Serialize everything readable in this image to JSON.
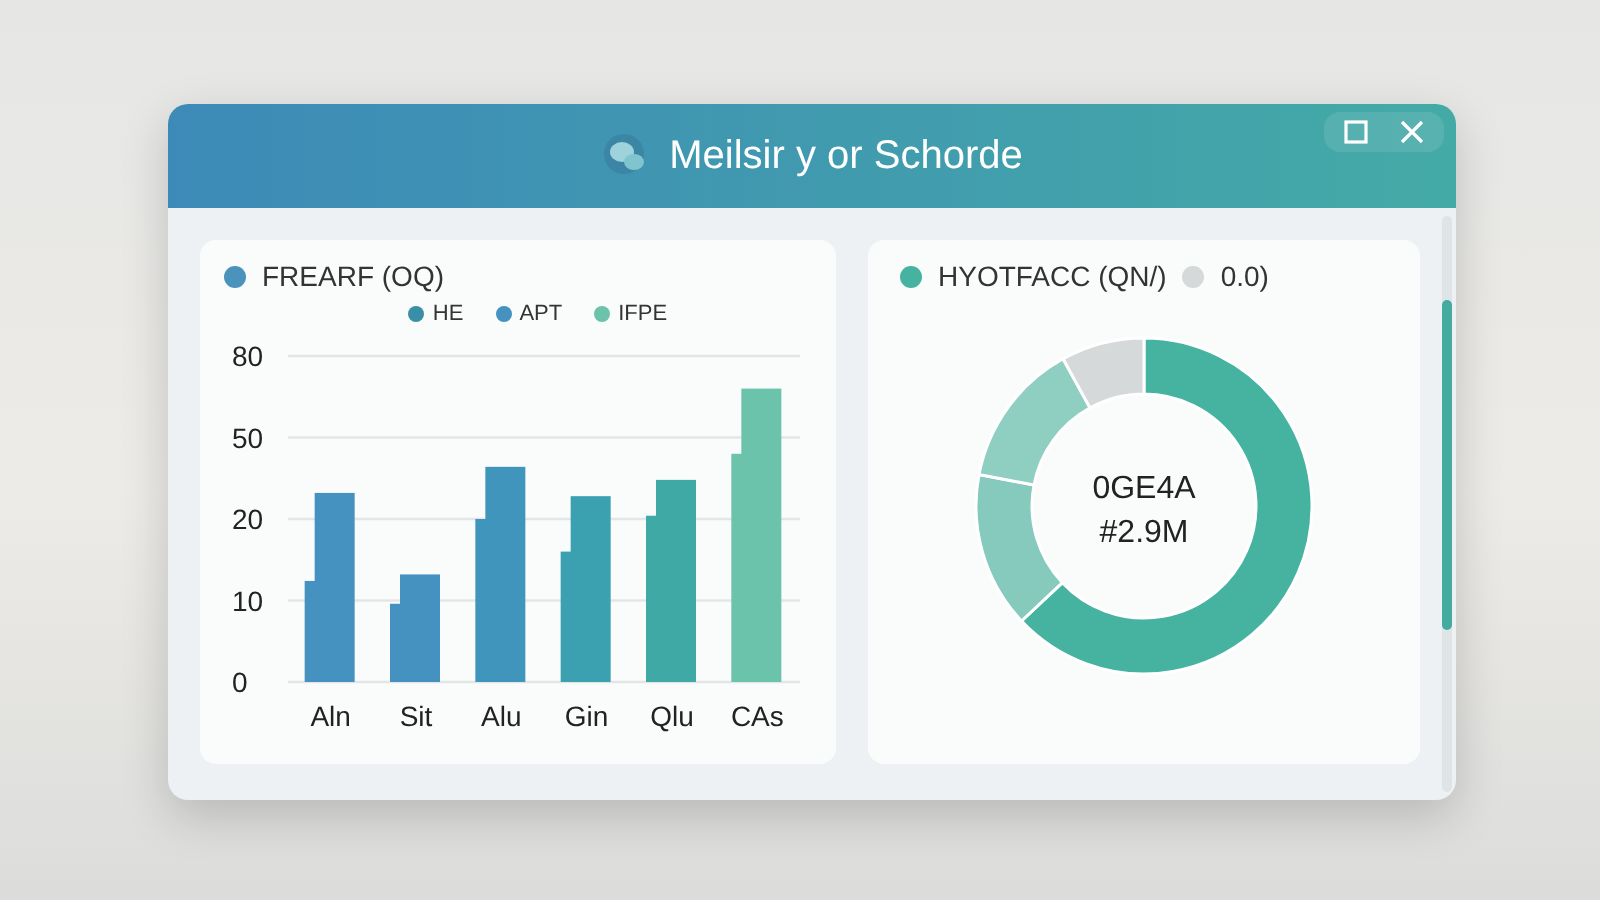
{
  "window": {
    "title": "Meilsir y or Schorde"
  },
  "bar_panel": {
    "legend_title": "FREARF (OQ)",
    "legend": [
      {
        "label": "HE",
        "color": "#3a8fa8"
      },
      {
        "label": "APT",
        "color": "#4592c0"
      },
      {
        "label": "IFPE",
        "color": "#6cc3ab"
      }
    ],
    "y_axis_labels": [
      "80",
      "50",
      "20",
      "10",
      "0"
    ],
    "categories": [
      "Aln",
      "Sit",
      "Alu",
      "Gin",
      "Qlu",
      "CAs"
    ]
  },
  "donut_panel": {
    "legend": [
      {
        "label": "HYOTFACC (QN/)",
        "color": "#45b3a0"
      },
      {
        "label": "0.0)",
        "color": "#d5d9da"
      }
    ],
    "center_lines": [
      "0GE4A",
      "#2.9M"
    ],
    "chart_data": {
      "type": "donut",
      "values": [
        63,
        15,
        14,
        8
      ],
      "colors": [
        "#45b3a0",
        "#86cabd",
        "#8fcfc2",
        "#d5d9da"
      ]
    }
  }
}
